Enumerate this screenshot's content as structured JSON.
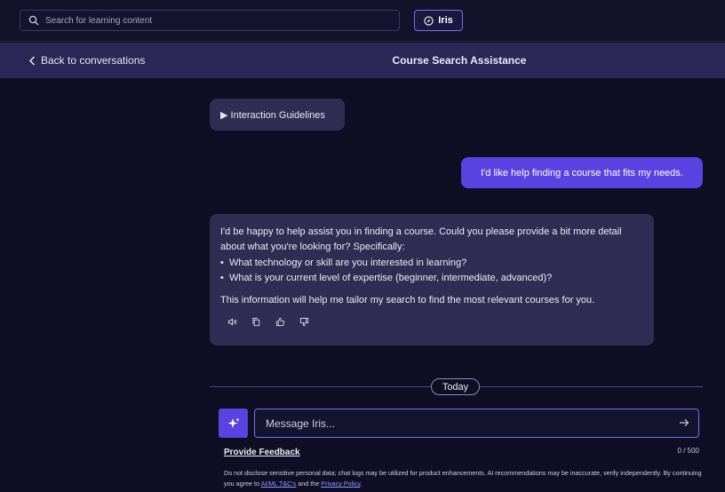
{
  "topbar": {
    "search_placeholder": "Search for learning content",
    "iris_label": "Iris"
  },
  "header": {
    "back_label": "Back to conversations",
    "title": "Course Search Assistance"
  },
  "chat": {
    "guidelines_label": "▶ Interaction Guidelines",
    "user_message": "I'd like help finding a course that fits my needs.",
    "bot_message": {
      "intro": "I'd be happy to help assist you in finding a course. Could you please provide a bit more detail about what you're looking for? Specifically:",
      "bullets": [
        "What technology or skill are you interested in learning?",
        "What is your current level of expertise (beginner, intermediate, advanced)?"
      ],
      "closing": "This information will help me tailor my search to find the most relevant courses for you."
    },
    "actions": [
      "speaker-icon",
      "copy-icon",
      "thumbs-up-icon",
      "thumbs-down-icon"
    ],
    "date_divider": "Today"
  },
  "composer": {
    "placeholder": "Message Iris...",
    "feedback_label": "Provide Feedback",
    "counter": "0 / 500",
    "disclaimer_text": "Do not disclose sensitive personal data; chat logs may be utilized for product enhancements. AI recommendations may be inaccurate, verify independently. By continuing you agree to",
    "link1": "AI/ML T&C's",
    "and_text": "and the",
    "link2": "Privacy Policy",
    "end": "."
  },
  "colors": {
    "accent": "#5a43e0",
    "bubble": "#302d55",
    "background": "#0f0e24"
  }
}
